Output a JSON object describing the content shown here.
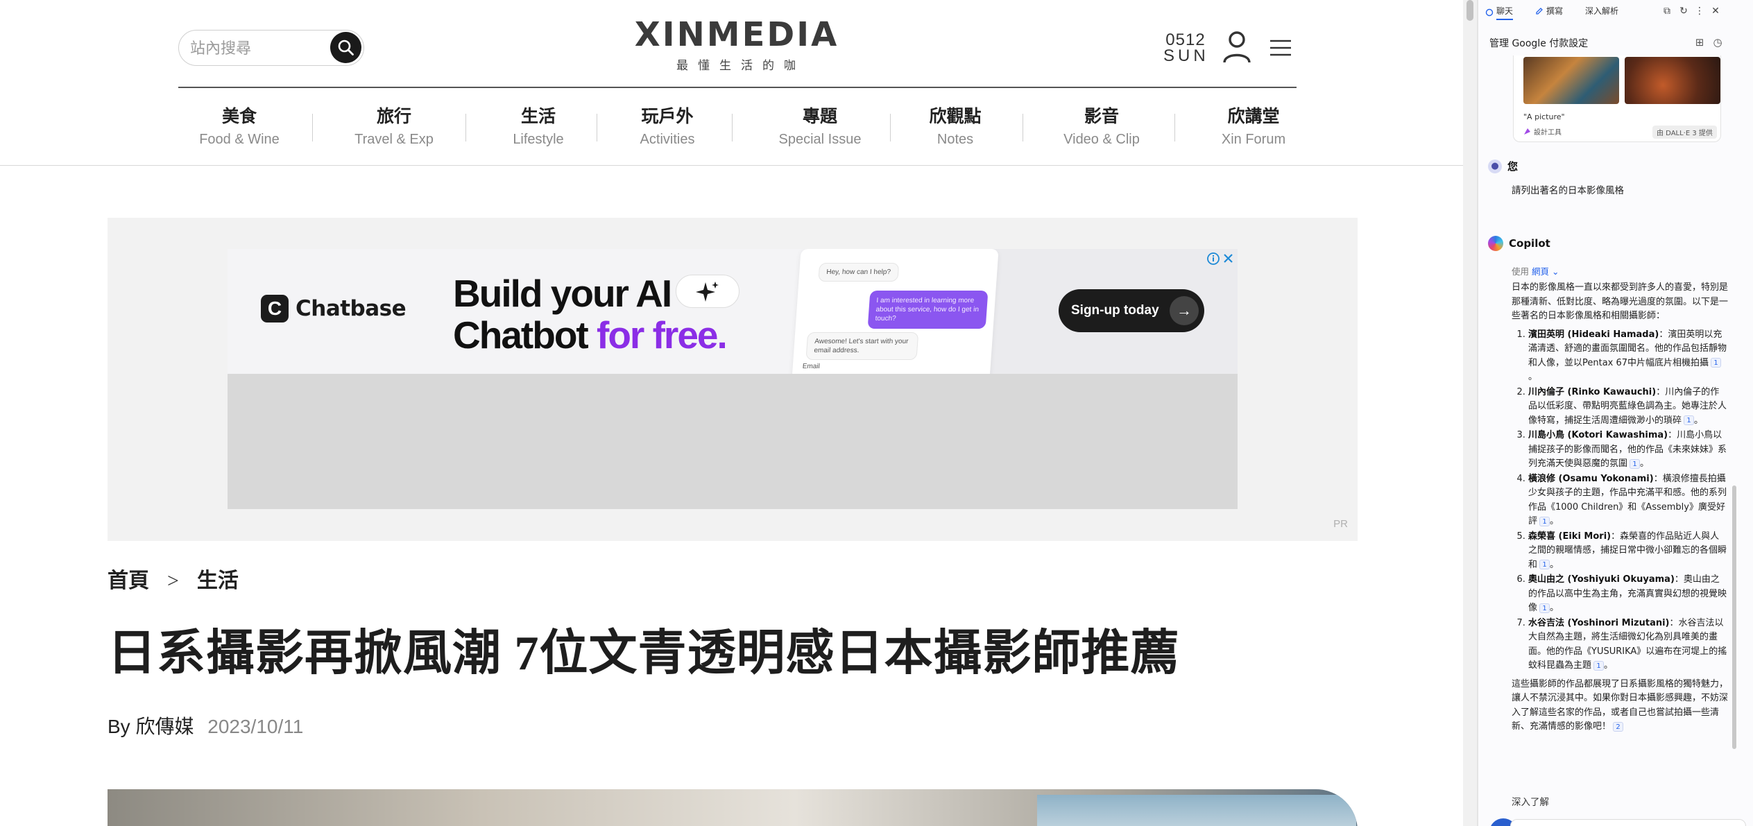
{
  "site": {
    "search_placeholder": "站內搜尋",
    "logo": "XINMEDIA",
    "tagline": "最懂生活的咖",
    "date_day": "0512",
    "date_weekday": "SUN",
    "nav": [
      {
        "zh": "美食",
        "en": "Food & Wine"
      },
      {
        "zh": "旅行",
        "en": "Travel & Exp"
      },
      {
        "zh": "生活",
        "en": "Lifestyle"
      },
      {
        "zh": "玩戶外",
        "en": "Activities"
      },
      {
        "zh": "專題",
        "en": "Special Issue"
      },
      {
        "zh": "欣觀點",
        "en": "Notes"
      },
      {
        "zh": "影音",
        "en": "Video & Clip"
      },
      {
        "zh": "欣講堂",
        "en": "Xin Forum"
      }
    ],
    "ad": {
      "brand": "Chatbase",
      "headline_1": "Build your AI",
      "headline_2a": "Chatbot ",
      "headline_2b": "for free.",
      "chat_1": "Hey, how can I help?",
      "chat_2": "I am interested in learning more about this service, how do I get in touch?",
      "chat_3": "Awesome! Let's start with your email address.",
      "chat_4": "Email",
      "cta": "Sign-up today",
      "cta_arrow": "→",
      "pr": "PR"
    },
    "breadcrumb_home": "首頁",
    "breadcrumb_sep": ">",
    "breadcrumb_section": "生活",
    "title": "日系攝影再掀風潮 7位文青透明感日本攝影師推薦",
    "byline_author": "By 欣傳媒",
    "byline_date": "2023/10/11"
  },
  "copilot": {
    "tabs": [
      "聊天",
      "撰寫",
      "深入解析"
    ],
    "manage_label": "管理 Google 付款設定",
    "image_caption": "\"A picture\"",
    "image_tool": "設計工具",
    "image_badge": "由 DALL·E 3 提供",
    "user_name": "您",
    "user_msg": "請列出著名的日本影像風格",
    "bot_name": "Copilot",
    "used_prefix": "使用 ",
    "used_source": "網頁",
    "intro": "日本的影像風格一直以來都受到許多人的喜愛，特別是那種清新、低對比度、略為曝光過度的氛圍。以下是一些著名的日本影像風格和相關攝影師：",
    "items": [
      {
        "name": "濱田英明 (Hideaki Hamada)",
        "desc": "：濱田英明以充滿清透、舒適的畫面氛圍聞名。他的作品包括靜物和人像，並以Pentax 67中片幅底片相機拍攝",
        "cite": "1"
      },
      {
        "name": "川內倫子 (Rinko Kawauchi)",
        "desc": "：川內倫子的作品以低彩度、帶點明亮藍綠色調為主。她專注於人像特寫，捕捉生活周遭細微渺小的瑣碎",
        "cite": "1"
      },
      {
        "name": "川島小鳥 (Kotori Kawashima)",
        "desc": "：川島小鳥以捕捉孩子的影像而聞名，他的作品《未來妹妹》系列充滿天使與惡魔的氛圍",
        "cite": "1"
      },
      {
        "name": "橫浪修 (Osamu Yokonami)",
        "desc": "：橫浪修擅長拍攝少女與孩子的主題，作品中充滿平和感。他的系列作品《1000 Children》和《Assembly》廣受好評",
        "cite": "1"
      },
      {
        "name": "森榮喜 (Eiki Mori)",
        "desc": "：森榮喜的作品貼近人與人之間的親暱情感，捕捉日常中微小卻難忘的各個瞬和",
        "cite": "1"
      },
      {
        "name": "奧山由之 (Yoshiyuki Okuyama)",
        "desc": "：奧山由之的作品以高中生為主角，充滿真實與幻想的視覺映像",
        "cite": "1"
      },
      {
        "name": "水谷吉法 (Yoshinori Mizutani)",
        "desc": "：水谷吉法以大自然為主題，將生活細微幻化為別具唯美的畫面。他的作品《YUSURIKA》以遍布在河堤上的搖蚊科昆蟲為主題",
        "cite": "1"
      }
    ],
    "outro": "這些攝影師的作品都展現了日系攝影風格的獨特魅力，讓人不禁沉浸其中。如果你對日本攝影感興趣，不妨深入了解這些名家的作品，或者自己也嘗試拍攝一些清新、充滿情感的影像吧！",
    "outro_cite": "2",
    "learn_more": "深入了解"
  }
}
